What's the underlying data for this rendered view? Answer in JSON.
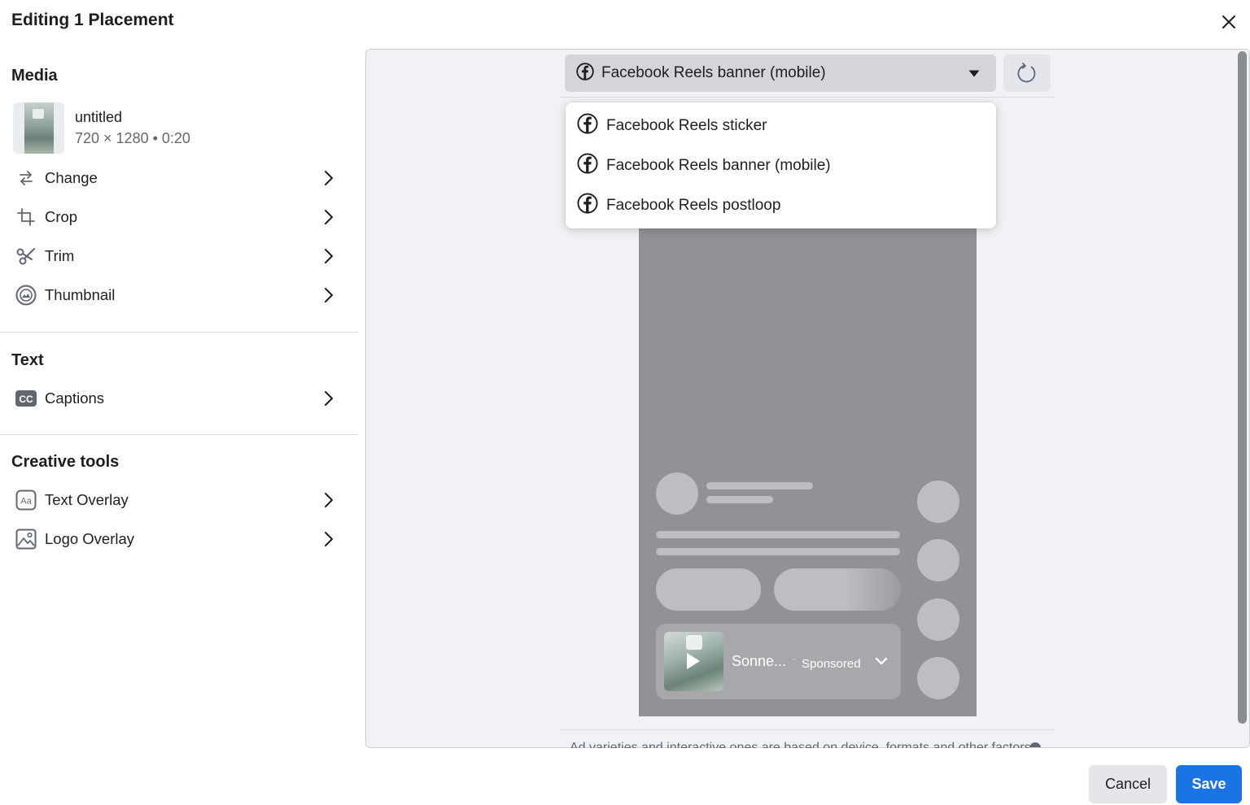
{
  "dialog": {
    "title": "Editing 1 Placement",
    "close_icon": "close-icon"
  },
  "left_panel": {
    "media": {
      "title": "Media",
      "file_name": "untitled",
      "file_meta": "720 × 1280 • 0:20",
      "items": [
        {
          "label": "Change",
          "icon": "swap-arrows-icon"
        },
        {
          "label": "Crop",
          "icon": "crop-icon"
        },
        {
          "label": "Trim",
          "icon": "scissors-icon"
        },
        {
          "label": "Thumbnail",
          "icon": "thumbnail-icon"
        }
      ]
    },
    "text": {
      "title": "Text",
      "items": [
        {
          "label": "Captions",
          "icon": "closed-captions-icon"
        }
      ]
    },
    "creative_tools": {
      "title": "Creative tools",
      "items": [
        {
          "label": "Text Overlay",
          "icon": "text-overlay-icon"
        },
        {
          "label": "Logo Overlay",
          "icon": "image-icon"
        }
      ]
    }
  },
  "preview": {
    "selected_placement": "Facebook Reels banner (mobile)",
    "placement_options": [
      "Facebook Reels sticker",
      "Facebook Reels banner (mobile)",
      "Facebook Reels postloop"
    ],
    "ad_card": {
      "name": "Sonne...",
      "separator": "·",
      "sponsored": "Sponsored"
    },
    "footer_note_partial": "Ad varieties and interactive ones are based on device, formats and other factors"
  },
  "footer": {
    "cancel_label": "Cancel",
    "save_label": "Save"
  },
  "colors": {
    "primary": "#1b74e4",
    "phone_bg": "#909296",
    "frame_bg": "#f0f2f5"
  }
}
